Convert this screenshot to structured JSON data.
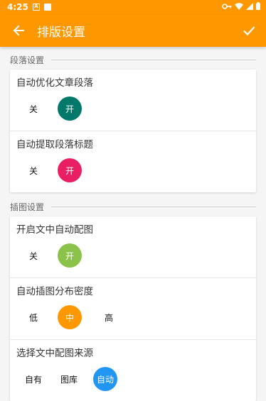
{
  "status_bar": {
    "time": "4:25",
    "notif_icon_letter": "A"
  },
  "app_bar": {
    "title": "排版设置"
  },
  "sections": [
    {
      "header": "段落设置",
      "rows": [
        {
          "label": "自动优化文章段落",
          "options": [
            "关",
            "开"
          ],
          "selected": 1,
          "color": "#00796b"
        },
        {
          "label": "自动提取段落标题",
          "options": [
            "关",
            "开"
          ],
          "selected": 1,
          "color": "#e91e63"
        }
      ]
    },
    {
      "header": "插图设置",
      "rows": [
        {
          "label": "开启文中自动配图",
          "options": [
            "关",
            "开"
          ],
          "selected": 1,
          "color": "#8bc34a"
        },
        {
          "label": "自动插图分布密度",
          "options": [
            "低",
            "中",
            "高"
          ],
          "selected": 1,
          "color": "#ff9800"
        },
        {
          "label": "选择文中配图来源",
          "options": [
            "自有",
            "图库",
            "自动"
          ],
          "selected": 2,
          "color": "#2196f3"
        }
      ]
    }
  ],
  "colors": {
    "primary": "#ff9800"
  }
}
